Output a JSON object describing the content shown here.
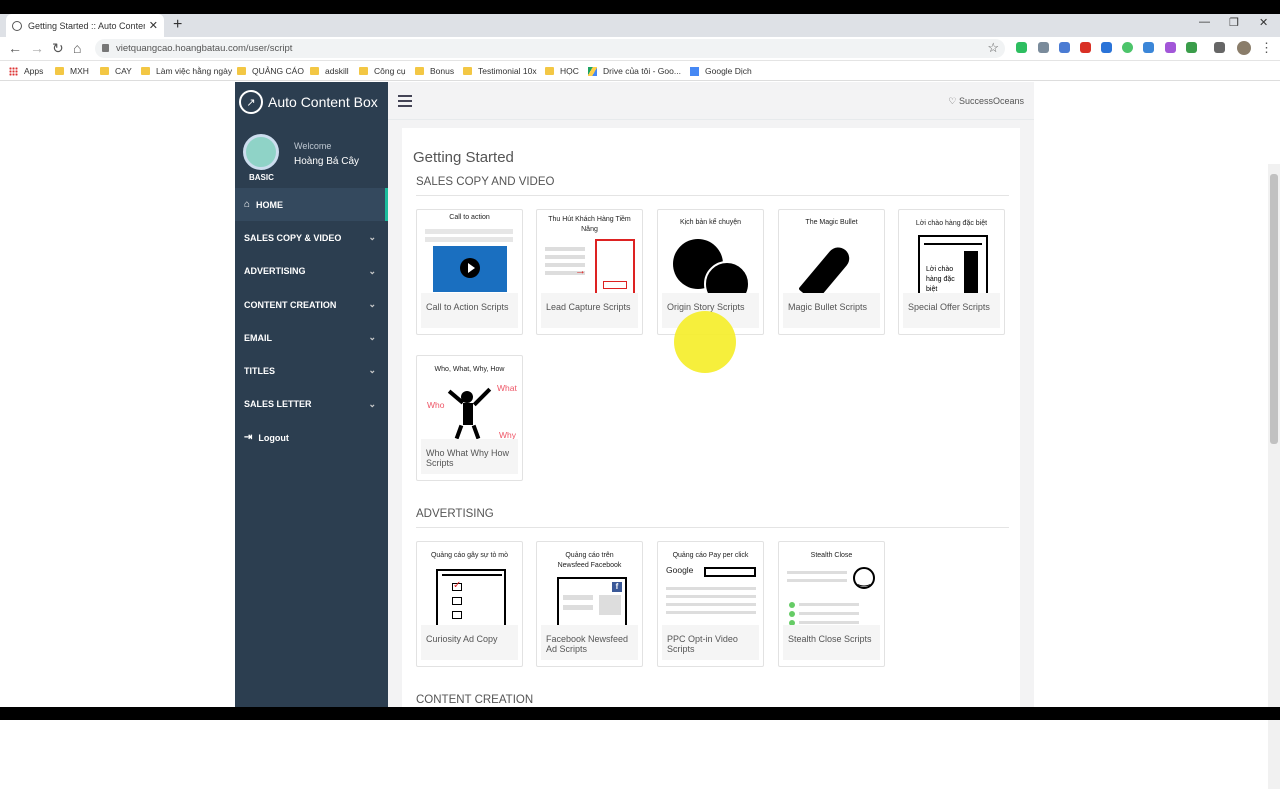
{
  "browser": {
    "tab_title": "Getting Started :: Auto Content B",
    "url": "vietquangcao.hoangbatau.com/user/script",
    "bookmarks": [
      "Apps",
      "MXH",
      "CAY",
      "Làm việc hằng ngày",
      "QUẢNG CÁO",
      "adskill",
      "Công cụ",
      "Bonus",
      "Testimonial 10x",
      "HỌC",
      "Drive của tôi - Goo...",
      "Google Dịch"
    ]
  },
  "app": {
    "logo_text": "Auto Content Box",
    "welcome": "Welcome",
    "user_name": "Hoàng Bá Cây",
    "level": "BASIC",
    "brand_link": "SuccessOceans"
  },
  "menu": [
    "HOME",
    "SALES COPY & VIDEO",
    "ADVERTISING",
    "CONTENT CREATION",
    "EMAIL",
    "TITLES",
    "SALES LETTER",
    "Logout"
  ],
  "main": {
    "title": "Getting Started",
    "sections": [
      "SALES COPY AND VIDEO",
      "ADVERTISING",
      "CONTENT CREATION"
    ],
    "sales_cards": [
      {
        "caption": "Call to action",
        "label": "Call to Action Scripts"
      },
      {
        "caption": "Thu Hút Khách Hàng Tiềm Năng",
        "label": "Lead Capture Scripts"
      },
      {
        "caption": "Kịch bản kể chuyện",
        "label": "Origin Story Scripts"
      },
      {
        "caption": "The Magic Bullet",
        "label": "Magic Bullet Scripts"
      },
      {
        "caption": "Lời chào hàng đặc biệt",
        "label": "Special Offer Scripts",
        "inner": "Lời chào hàng đặc biệt"
      },
      {
        "caption": "Who, What, Why, How",
        "label": "Who What Why How Scripts",
        "w1": "Who",
        "w2": "What",
        "w3": "Why"
      }
    ],
    "ad_cards": [
      {
        "caption": "Quảng cáo gây sự tò mò",
        "label": "Curiosity Ad Copy"
      },
      {
        "caption": "Quảng cáo trên Newsfeed Facebook",
        "label": "Facebook Newsfeed Ad Scripts"
      },
      {
        "caption": "Quảng cáo Pay per click",
        "label": "PPC Opt-in Video Scripts",
        "google": "Google"
      },
      {
        "caption": "Stealth Close",
        "label": "Stealth Close Scripts"
      }
    ]
  }
}
